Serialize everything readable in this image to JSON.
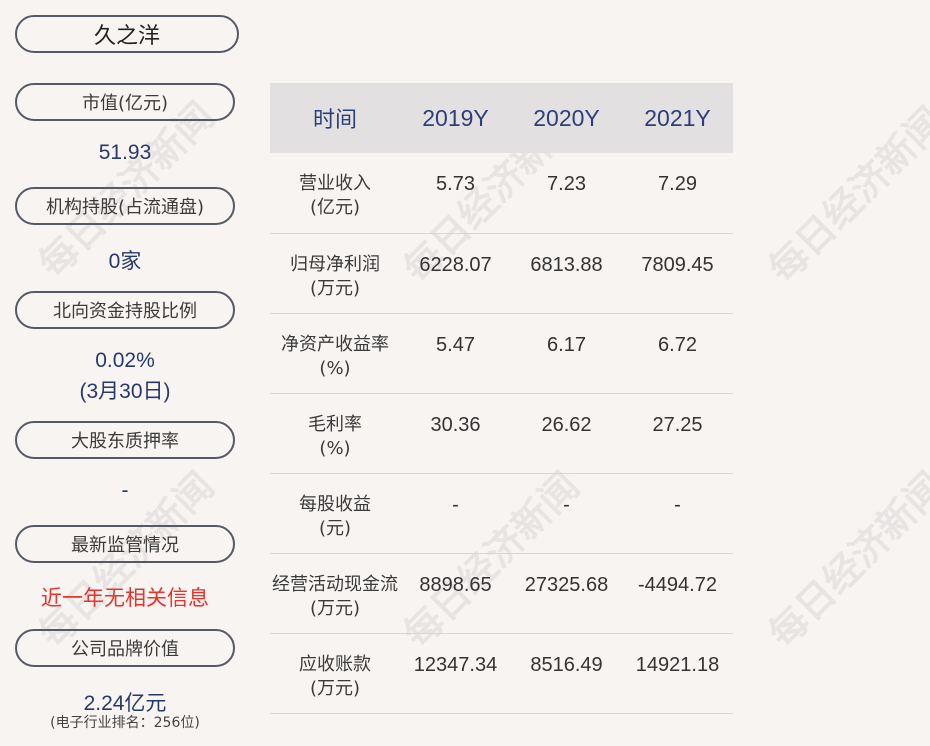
{
  "company": "久之洋",
  "metrics": {
    "market_cap": {
      "label": "市值(亿元)",
      "value": "51.93"
    },
    "institution": {
      "label": "机构持股(占流通盘)",
      "value": "0家"
    },
    "northbound": {
      "label": "北向资金持股比例",
      "value": "0.02%",
      "date": "(3月30日)"
    },
    "pledge": {
      "label": "大股东质押率",
      "value": "-"
    },
    "supervision": {
      "label": "最新监管情况",
      "value": "近一年无相关信息"
    },
    "brand": {
      "label": "公司品牌价值",
      "value": "2.24亿元",
      "sub": "(电子行业排名：256位)"
    }
  },
  "table": {
    "header": [
      "时间",
      "2019Y",
      "2020Y",
      "2021Y"
    ],
    "rows": [
      {
        "name": "营业收入",
        "unit": "(亿元)",
        "values": [
          "5.73",
          "7.23",
          "7.29"
        ]
      },
      {
        "name": "归母净利润",
        "unit": "(万元)",
        "values": [
          "6228.07",
          "6813.88",
          "7809.45"
        ]
      },
      {
        "name": "净资产收益率",
        "unit": "(%)",
        "values": [
          "5.47",
          "6.17",
          "6.72"
        ]
      },
      {
        "name": "毛利率",
        "unit": "(%)",
        "values": [
          "30.36",
          "26.62",
          "27.25"
        ]
      },
      {
        "name": "每股收益",
        "unit": "(元)",
        "values": [
          "-",
          "-",
          "-"
        ]
      },
      {
        "name": "经营活动现金流",
        "unit": "(万元)",
        "values": [
          "8898.65",
          "27325.68",
          "-4494.72"
        ]
      },
      {
        "name": "应收账款",
        "unit": "(万元)",
        "values": [
          "12347.34",
          "8516.49",
          "14921.18"
        ]
      }
    ]
  },
  "watermark_text": "每日经济新闻"
}
